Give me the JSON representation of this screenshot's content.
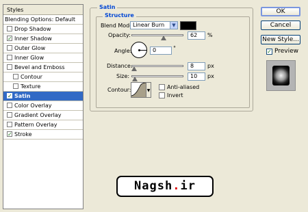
{
  "styles_panel": {
    "header": "Styles",
    "items": [
      {
        "label": "Blending Options: Default",
        "checkbox": false,
        "checked": false,
        "selected": false,
        "indent": 0
      },
      {
        "label": "Drop Shadow",
        "checkbox": true,
        "checked": false,
        "selected": false,
        "indent": 0
      },
      {
        "label": "Inner Shadow",
        "checkbox": true,
        "checked": true,
        "selected": false,
        "indent": 0
      },
      {
        "label": "Outer Glow",
        "checkbox": true,
        "checked": false,
        "selected": false,
        "indent": 0
      },
      {
        "label": "Inner Glow",
        "checkbox": true,
        "checked": false,
        "selected": false,
        "indent": 0
      },
      {
        "label": "Bevel and Emboss",
        "checkbox": true,
        "checked": false,
        "selected": false,
        "indent": 0
      },
      {
        "label": "Contour",
        "checkbox": true,
        "checked": false,
        "selected": false,
        "indent": 1
      },
      {
        "label": "Texture",
        "checkbox": true,
        "checked": false,
        "selected": false,
        "indent": 1
      },
      {
        "label": "Satin",
        "checkbox": true,
        "checked": true,
        "selected": true,
        "indent": 0
      },
      {
        "label": "Color Overlay",
        "checkbox": true,
        "checked": false,
        "selected": false,
        "indent": 0
      },
      {
        "label": "Gradient Overlay",
        "checkbox": true,
        "checked": false,
        "selected": false,
        "indent": 0
      },
      {
        "label": "Pattern Overlay",
        "checkbox": true,
        "checked": false,
        "selected": false,
        "indent": 0
      },
      {
        "label": "Stroke",
        "checkbox": true,
        "checked": true,
        "selected": false,
        "indent": 0
      }
    ]
  },
  "satin": {
    "group_title": "Satin",
    "structure_title": "Structure",
    "blend_mode_label": "Blend Mode:",
    "blend_mode_value": "Linear Burn",
    "swatch_color": "#000000",
    "opacity_label": "Opacity:",
    "opacity_value": "62",
    "opacity_unit": "%",
    "angle_label": "Angle:",
    "angle_value": "0",
    "angle_unit": "°",
    "distance_label": "Distance:",
    "distance_value": "8",
    "distance_unit": "px",
    "size_label": "Size:",
    "size_value": "10",
    "size_unit": "px",
    "contour_label": "Contour:",
    "anti_aliased_label": "Anti-aliased",
    "anti_aliased_checked": false,
    "invert_label": "Invert",
    "invert_checked": false
  },
  "buttons": {
    "ok": "OK",
    "cancel": "Cancel",
    "new_style": "New Style...",
    "preview_label": "Preview",
    "preview_checked": true
  },
  "watermark": {
    "text_a": "Nagsh",
    "text_dot": ".",
    "text_b": "ir"
  },
  "colors": {
    "selection": "#316ac5",
    "group_title": "#0046d5",
    "background": "#ece9d8"
  }
}
